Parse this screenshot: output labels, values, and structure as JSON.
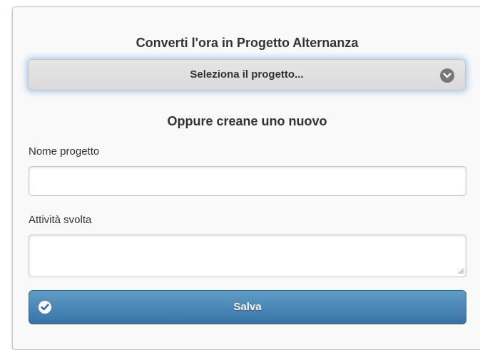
{
  "header": {
    "title": "Converti l'ora in Progetto Alternanza"
  },
  "project_select": {
    "selected_label": "Seleziona il progetto...",
    "icon": "chevron-down-circle-icon"
  },
  "new_project": {
    "heading": "Oppure creane uno nuovo",
    "name_label": "Nome progetto",
    "name_value": "",
    "activity_label": "Attività svolta",
    "activity_value": ""
  },
  "actions": {
    "save_label": "Salva",
    "save_icon": "check-circle-icon"
  },
  "colors": {
    "accent": "#3f7fb3",
    "focus_glow": "#5da2dd"
  }
}
